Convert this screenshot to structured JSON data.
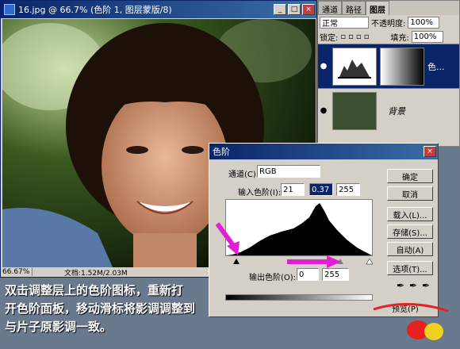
{
  "doc_window": {
    "title": "16.jpg @ 66.7% (色阶 1, 图层蒙版/8)",
    "min_glyph": "_",
    "max_glyph": "□",
    "close_glyph": "×",
    "zoom": "66.67%",
    "docinfo": "文档:1.52M/2.03M"
  },
  "layers_panel": {
    "tabs": [
      "通道",
      "路径",
      "图层"
    ],
    "blend_mode": "正常",
    "opacity_label": "不透明度:",
    "opacity_value": "100%",
    "lock_label": "锁定:",
    "fill_label": "填充:",
    "fill_value": "100%",
    "layers": [
      {
        "name": "色...",
        "selected": true
      },
      {
        "name": "背景",
        "selected": false
      }
    ]
  },
  "levels_dialog": {
    "title": "色阶",
    "channel_label": "通道(C):",
    "channel_value": "RGB",
    "input_label": "输入色阶(I):",
    "input_values": [
      "21",
      "0.37",
      "255"
    ],
    "output_label": "输出色阶(O):",
    "output_values": [
      "0",
      "255"
    ],
    "buttons": [
      "确定",
      "取消",
      "载入(L)...",
      "存储(S)...",
      "自动(A)",
      "选项(T)..."
    ],
    "preview_label": "预览(P)"
  },
  "caption": {
    "lines": [
      "双击调整层上的色阶图标，重新打",
      "开色阶面板，移动滑标将影调调整到",
      "与片子原影调一致。"
    ]
  },
  "colors": {
    "titlebar": "#0a246a",
    "arrow": "#e020d0",
    "dialog_bg": "#d4d0c8"
  }
}
